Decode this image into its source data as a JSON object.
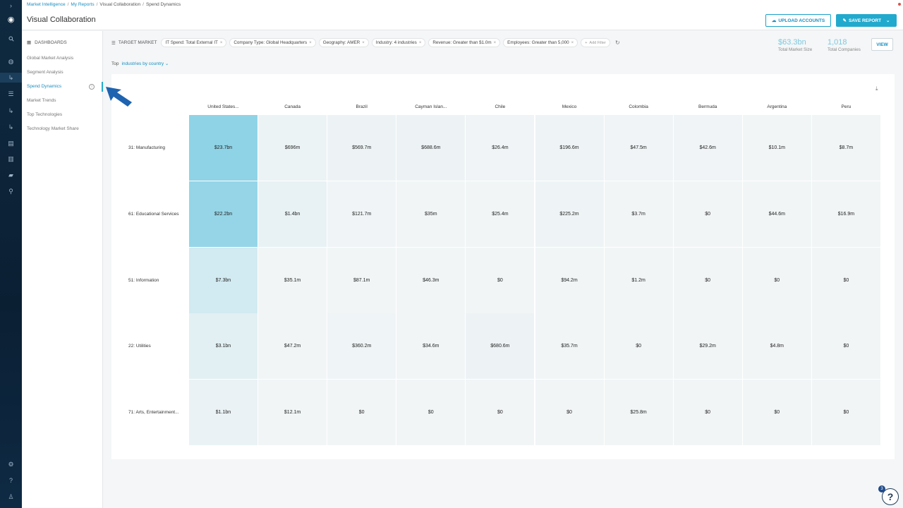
{
  "breadcrumb": [
    "Market Intelligence",
    "My Reports",
    "Visual Collaboration",
    "Spend Dynamics"
  ],
  "title": "Visual Collaboration",
  "buttons": {
    "upload": "UPLOAD ACCOUNTS",
    "save": "SAVE REPORT",
    "view": "VIEW"
  },
  "rail_icons": [
    "chevron-right-icon",
    "logo-icon",
    "search-icon",
    "globe-icon",
    "enter-icon",
    "list-icon",
    "enter-icon",
    "enter-icon",
    "book-icon",
    "table-icon",
    "chat-icon",
    "network-icon",
    "gear-icon",
    "help-icon",
    "user-icon"
  ],
  "sidebar": {
    "heading": "DASHBOARDS",
    "items": [
      {
        "label": "Global Market Analysis",
        "active": false
      },
      {
        "label": "Segment Analysis",
        "active": false
      },
      {
        "label": "Spend Dynamics",
        "active": true
      },
      {
        "label": "Market Trends",
        "active": false
      },
      {
        "label": "Top Technologies",
        "active": false
      },
      {
        "label": "Technology Market Share",
        "active": false
      }
    ]
  },
  "filters": {
    "target_label": "TARGET MARKET",
    "chips": [
      "IT Spend: Total External IT",
      "Company Type: Global Headquarters",
      "Geography: AMER",
      "Industry: 4 industries",
      "Revenue: Greater than $1.0m",
      "Employees: Greater than 5,000"
    ],
    "add_label": "Add Filter"
  },
  "top_selector": {
    "label": "Top",
    "value": "industries by country"
  },
  "stats": [
    {
      "value": "$63.3bn",
      "label": "Total Market Size"
    },
    {
      "value": "1,018",
      "label": "Total Companies"
    }
  ],
  "heatmap": {
    "columns": [
      "United States...",
      "Canada",
      "Brazil",
      "Cayman Islan...",
      "Chile",
      "Mexico",
      "Colombia",
      "Bermuda",
      "Argentina",
      "Peru"
    ],
    "rows": [
      {
        "label": "31: Manufacturing",
        "intensity": [
          1.0,
          0.06,
          0.05,
          0.05,
          0.02,
          0.04,
          0.02,
          0.02,
          0.01,
          0.01
        ],
        "cells": [
          "$23.7bn",
          "$696m",
          "$569.7m",
          "$688.6m",
          "$26.4m",
          "$196.6m",
          "$47.5m",
          "$42.6m",
          "$10.1m",
          "$8.7m"
        ]
      },
      {
        "label": "61: Educational Services",
        "intensity": [
          0.94,
          0.1,
          0.02,
          0.01,
          0.01,
          0.04,
          0.0,
          0.0,
          0.01,
          0.01
        ],
        "cells": [
          "$22.2bn",
          "$1.4bn",
          "$121.7m",
          "$35m",
          "$25.4m",
          "$225.2m",
          "$3.7m",
          "$0",
          "$44.6m",
          "$16.9m"
        ]
      },
      {
        "label": "51: Information",
        "intensity": [
          0.32,
          0.01,
          0.01,
          0.01,
          0.0,
          0.01,
          0.0,
          0.0,
          0.0,
          0.0
        ],
        "cells": [
          "$7.3bn",
          "$35.1m",
          "$87.1m",
          "$46.3m",
          "$0",
          "$94.2m",
          "$1.2m",
          "$0",
          "$0",
          "$0"
        ]
      },
      {
        "label": "22: Utilities",
        "intensity": [
          0.16,
          0.01,
          0.03,
          0.01,
          0.05,
          0.01,
          0.0,
          0.01,
          0.0,
          0.0
        ],
        "cells": [
          "$3.1bn",
          "$47.2m",
          "$360.2m",
          "$34.6m",
          "$680.6m",
          "$35.7m",
          "$0",
          "$29.2m",
          "$4.8m",
          "$0"
        ]
      },
      {
        "label": "71: Arts, Entertainment...",
        "intensity": [
          0.08,
          0.01,
          0.0,
          0.0,
          0.0,
          0.0,
          0.01,
          0.0,
          0.0,
          0.0
        ],
        "cells": [
          "$1.1bn",
          "$12.1m",
          "$0",
          "$0",
          "$0",
          "$0",
          "$25.8m",
          "$0",
          "$0",
          "$0"
        ]
      }
    ]
  },
  "help_badge": "3",
  "colors": {
    "accent": "#21aacd",
    "link": "#1a8fc1",
    "rail": "#0f2a40",
    "heat_high": "#8fd3e6",
    "heat_low": "#f2f5f6",
    "pointer": "#1e63b0"
  }
}
